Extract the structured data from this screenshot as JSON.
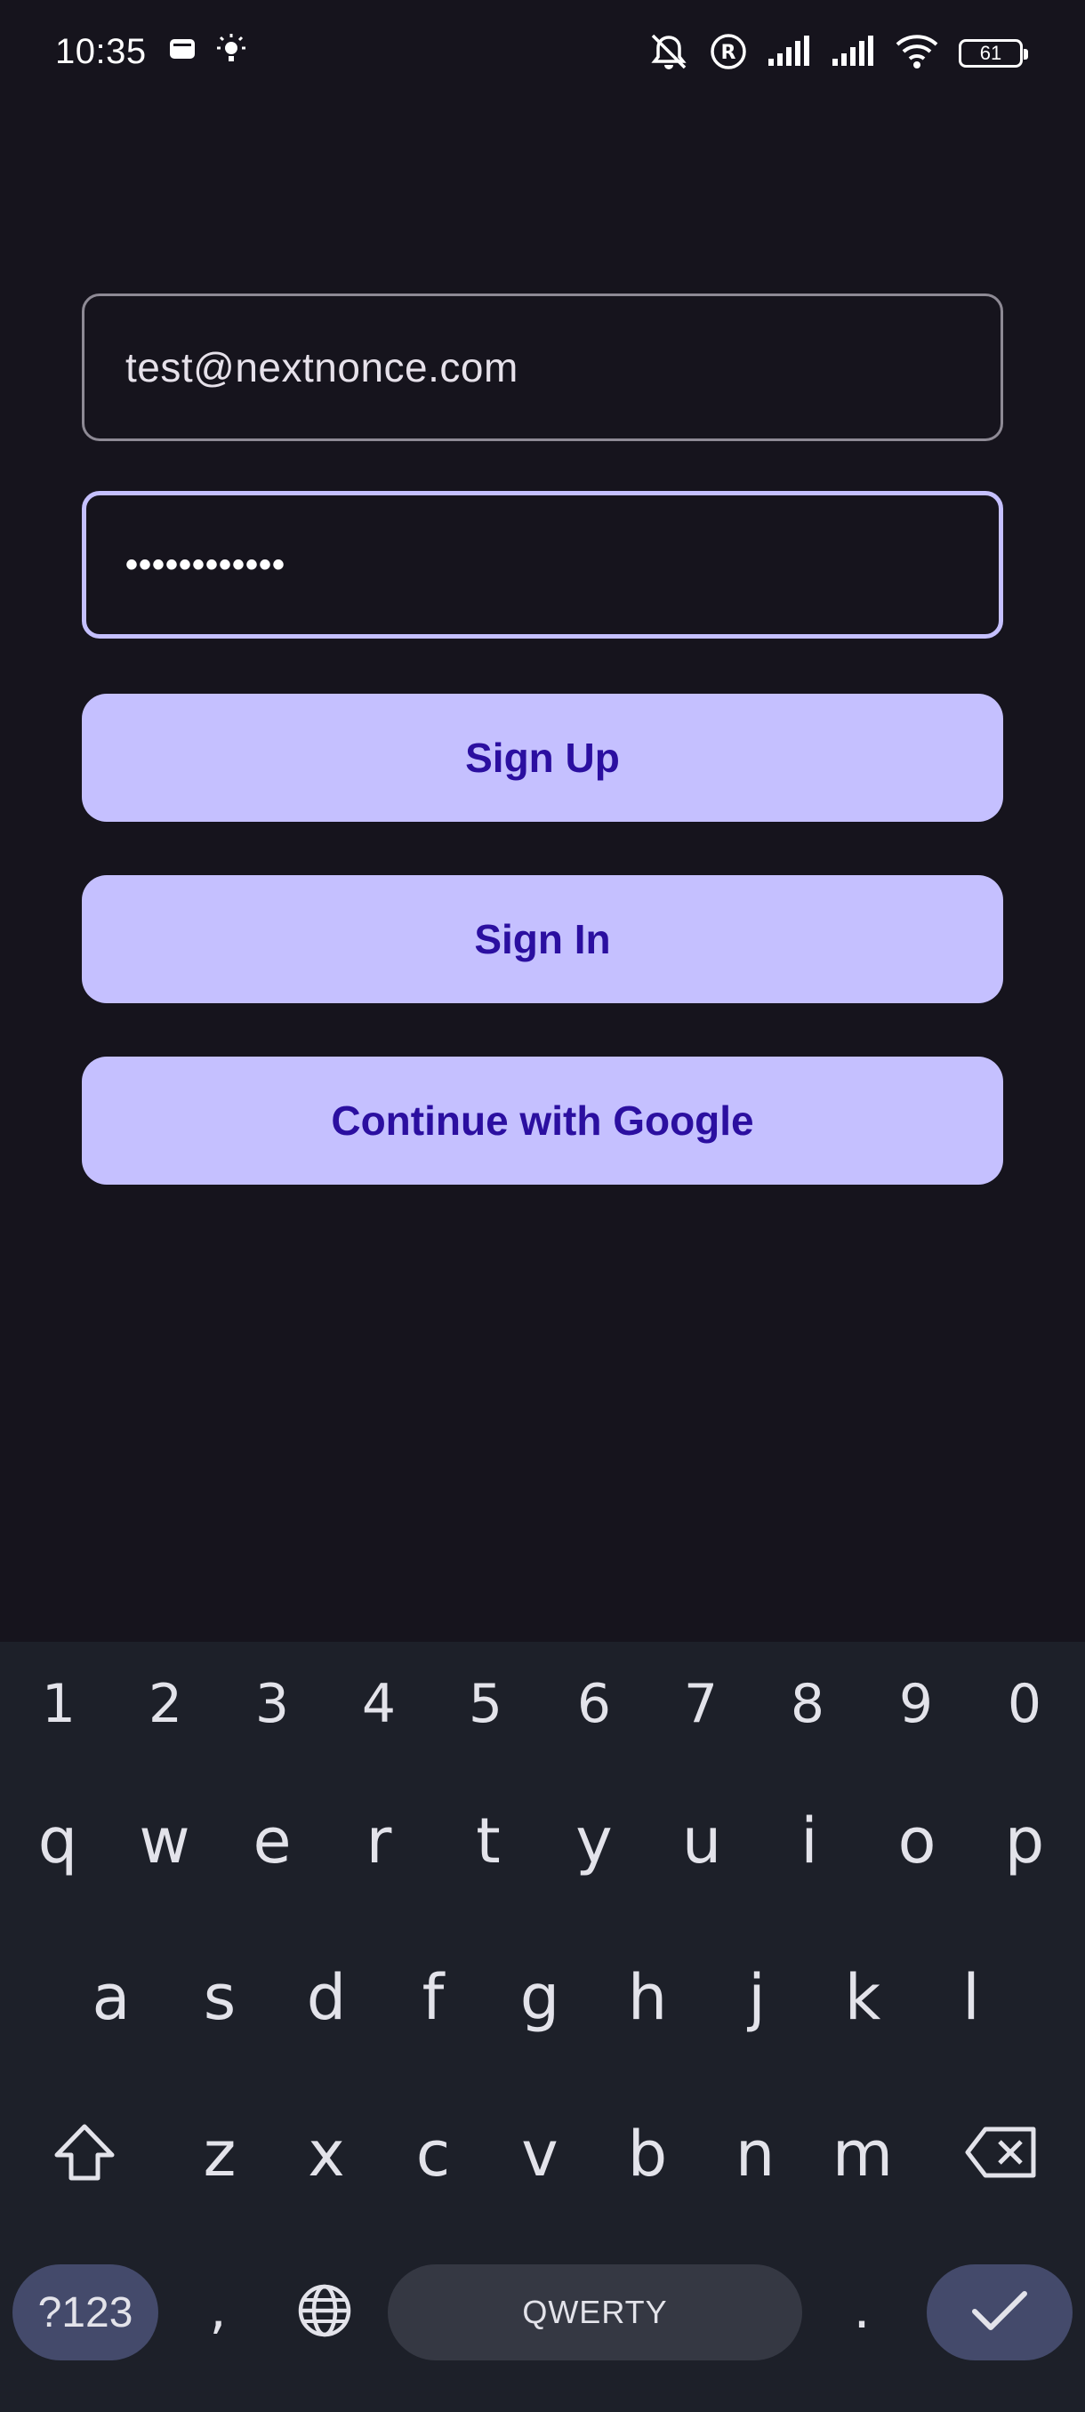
{
  "status_bar": {
    "time": "10:35",
    "battery": "61",
    "icons": [
      "wallet-icon",
      "brightness-icon",
      "bell-off-icon",
      "registered-icon",
      "signal-icon",
      "signal-icon",
      "wifi-icon",
      "battery-icon"
    ]
  },
  "form": {
    "email_value": "test@nextnonce.com",
    "password_masked": "••••••••••••",
    "signup_label": "Sign Up",
    "signin_label": "Sign In",
    "google_label": "Continue with Google"
  },
  "keyboard": {
    "numbers": [
      "1",
      "2",
      "3",
      "4",
      "5",
      "6",
      "7",
      "8",
      "9",
      "0"
    ],
    "row1": [
      "q",
      "w",
      "e",
      "r",
      "t",
      "y",
      "u",
      "i",
      "o",
      "p"
    ],
    "row2": [
      "a",
      "s",
      "d",
      "f",
      "g",
      "h",
      "j",
      "k",
      "l"
    ],
    "row3": [
      "z",
      "x",
      "c",
      "v",
      "b",
      "n",
      "m"
    ],
    "symbols_label": "?123",
    "comma_label": ",",
    "space_label": "QWERTY",
    "period_label": ".",
    "accent_color": "#444a6b"
  },
  "colors": {
    "background": "#16141d",
    "button": "#c5c0ff",
    "button_text": "#2b0fa0",
    "focused_border": "#c5c0ff"
  }
}
